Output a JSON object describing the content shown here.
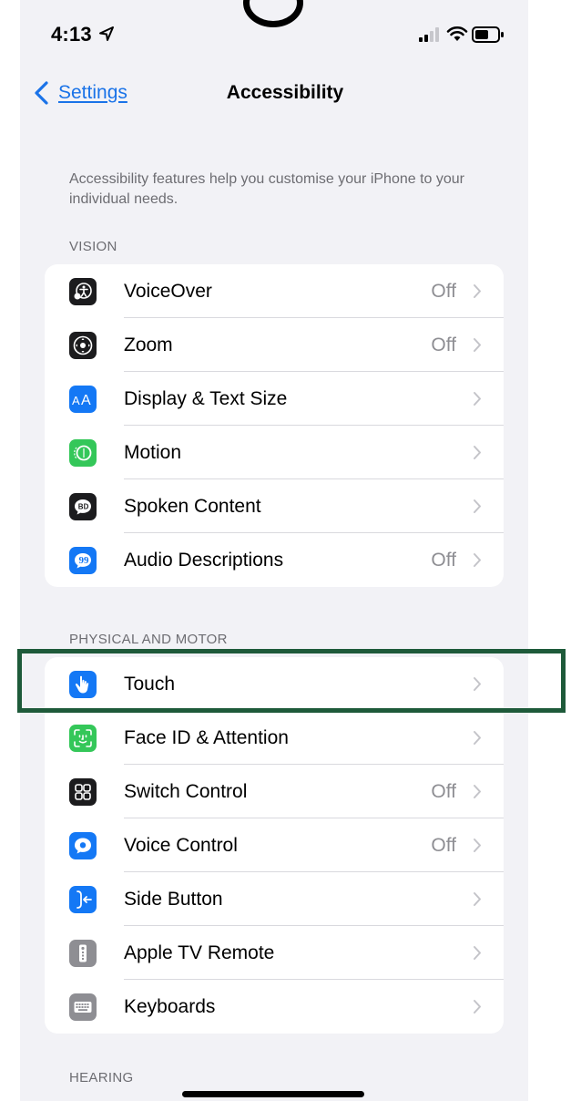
{
  "status_bar": {
    "time": "4:13"
  },
  "nav": {
    "back_label": "Settings",
    "title": "Accessibility"
  },
  "intro_text": "Accessibility features help you customise your iPhone to your individual needs.",
  "sections": {
    "vision": {
      "header": "VISION",
      "items": [
        {
          "label": "VoiceOver",
          "value": "Off",
          "icon": "voiceover-icon",
          "color": "#1c1c1e"
        },
        {
          "label": "Zoom",
          "value": "Off",
          "icon": "zoom-icon",
          "color": "#1c1c1e"
        },
        {
          "label": "Display & Text Size",
          "value": "",
          "icon": "display-text-size-icon",
          "color": "#1478f5"
        },
        {
          "label": "Motion",
          "value": "",
          "icon": "motion-icon",
          "color": "#34c759"
        },
        {
          "label": "Spoken Content",
          "value": "",
          "icon": "spoken-content-icon",
          "color": "#1c1c1e"
        },
        {
          "label": "Audio Descriptions",
          "value": "Off",
          "icon": "audio-descriptions-icon",
          "color": "#1478f5"
        }
      ]
    },
    "physical": {
      "header": "PHYSICAL AND MOTOR",
      "items": [
        {
          "label": "Touch",
          "value": "",
          "icon": "touch-icon",
          "color": "#1478f5"
        },
        {
          "label": "Face ID & Attention",
          "value": "",
          "icon": "face-id-icon",
          "color": "#34c759"
        },
        {
          "label": "Switch Control",
          "value": "Off",
          "icon": "switch-control-icon",
          "color": "#1c1c1e"
        },
        {
          "label": "Voice Control",
          "value": "Off",
          "icon": "voice-control-icon",
          "color": "#1478f5"
        },
        {
          "label": "Side Button",
          "value": "",
          "icon": "side-button-icon",
          "color": "#1478f5"
        },
        {
          "label": "Apple TV Remote",
          "value": "",
          "icon": "apple-tv-remote-icon",
          "color": "#8e8e93"
        },
        {
          "label": "Keyboards",
          "value": "",
          "icon": "keyboards-icon",
          "color": "#8e8e93"
        }
      ]
    },
    "hearing": {
      "header": "HEARING"
    }
  },
  "highlight_color": "#1e5a3a"
}
